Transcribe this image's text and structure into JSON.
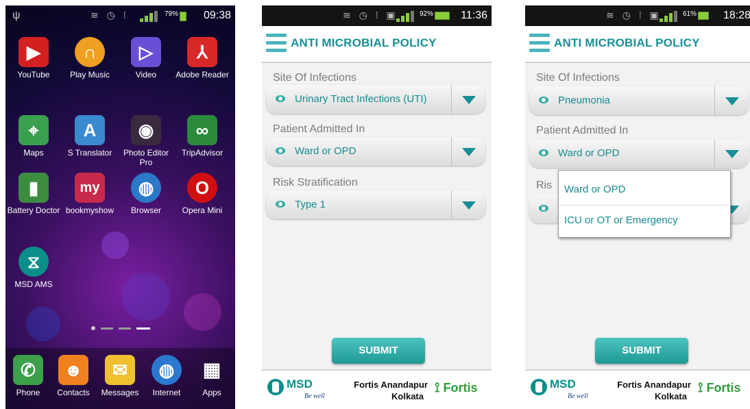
{
  "home": {
    "time": "09:38",
    "battery": "79%",
    "apps": [
      {
        "label": "YouTube",
        "icon": "youtube-icon",
        "color": "#d32020"
      },
      {
        "label": "Play Music",
        "icon": "headphones-icon",
        "color": "#f0a020"
      },
      {
        "label": "Video",
        "icon": "play-icon",
        "color": "#6a4fd6"
      },
      {
        "label": "Adobe Reader",
        "icon": "pdf-icon",
        "color": "#d82828"
      },
      {
        "label": "Maps",
        "icon": "map-icon",
        "color": "#3aa050"
      },
      {
        "label": "S Translator",
        "icon": "translate-icon",
        "color": "#3a8ad0"
      },
      {
        "label": "Photo Editor Pro",
        "icon": "camera-icon",
        "color": "#3a2a40"
      },
      {
        "label": "TripAdvisor",
        "icon": "owl-icon",
        "color": "#2c8a3c"
      },
      {
        "label": "Battery Doctor",
        "icon": "battery-icon",
        "color": "#3c8c40"
      },
      {
        "label": "bookmyshow",
        "icon": "ticket-icon",
        "color": "#c72a4a"
      },
      {
        "label": "Browser",
        "icon": "globe-icon",
        "color": "#2c78c8"
      },
      {
        "label": "Opera Mini",
        "icon": "opera-icon",
        "color": "#d01010"
      },
      {
        "label": "MSD AMS",
        "icon": "msd-icon",
        "color": "#0a8f8a"
      }
    ],
    "dock": [
      {
        "label": "Phone",
        "icon": "phone-icon",
        "color": "#3ca04a"
      },
      {
        "label": "Contacts",
        "icon": "contacts-icon",
        "color": "#f08020"
      },
      {
        "label": "Messages",
        "icon": "envelope-icon",
        "color": "#f0c030"
      },
      {
        "label": "Internet",
        "icon": "globe-icon",
        "color": "#2a78d0"
      },
      {
        "label": "Apps",
        "icon": "grid-icon",
        "color": "#555555"
      }
    ]
  },
  "screen1": {
    "time": "11:36",
    "battery": "92%",
    "title": "ANTI MICROBIAL POLICY",
    "site_label": "Site Of Infections",
    "site_value": "Urinary Tract Infections (UTI)",
    "admitted_label": "Patient Admitted In",
    "admitted_value": "Ward or OPD",
    "risk_label": "Risk Stratification",
    "risk_value": "Type 1",
    "submit": "SUBMIT"
  },
  "screen2": {
    "time": "18:28",
    "battery": "61%",
    "title": "ANTI MICROBIAL POLICY",
    "site_label": "Site Of Infections",
    "site_value": "Pneumonia",
    "admitted_label": "Patient Admitted In",
    "admitted_value": "Ward or OPD",
    "risk_label_partial": "Ris",
    "dropdown_options": [
      "Ward or OPD",
      "ICU or OT or Emergency"
    ],
    "submit": "SUBMIT"
  },
  "footer": {
    "msd": "MSD",
    "msd_tag": "Be well",
    "hospital_line1": "Fortis Anandapur",
    "hospital_line2": "Kolkata",
    "fortis": "Fortis"
  },
  "colors": {
    "accent": "#178f96",
    "button": "#2fb0ab",
    "fortis_green": "#2e9d3a"
  }
}
